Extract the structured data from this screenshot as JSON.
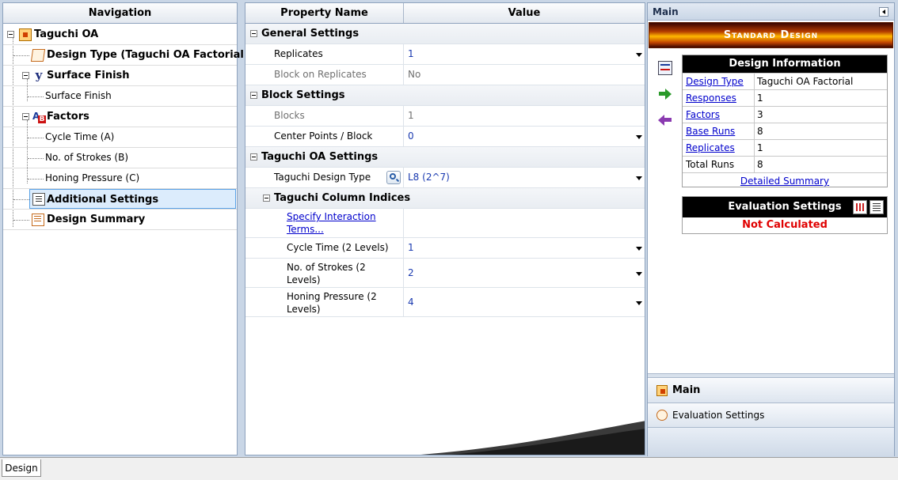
{
  "navigation": {
    "title": "Navigation",
    "items": [
      {
        "label": "Taguchi OA",
        "level": 0,
        "icon": "taguchi-oa-icon",
        "bold": true
      },
      {
        "label": "Design Type (Taguchi OA Factorial)",
        "level": 1,
        "icon": "design-type-icon",
        "bold": true
      },
      {
        "label": "Surface Finish",
        "level": 1,
        "icon": "response-y-icon",
        "bold": true
      },
      {
        "label": "Surface Finish",
        "level": 2,
        "bold": false
      },
      {
        "label": "Factors",
        "level": 1,
        "icon": "factors-ab-icon",
        "bold": true
      },
      {
        "label": "Cycle Time (A)",
        "level": 2,
        "bold": false
      },
      {
        "label": "No. of Strokes (B)",
        "level": 2,
        "bold": false
      },
      {
        "label": "Honing Pressure (C)",
        "level": 2,
        "bold": false
      },
      {
        "label": "Additional Settings",
        "level": 1,
        "icon": "list-settings-icon",
        "bold": true,
        "selected": true
      },
      {
        "label": "Design Summary",
        "level": 1,
        "icon": "design-summary-icon",
        "bold": true
      }
    ]
  },
  "grid": {
    "header_property": "Property Name",
    "header_value": "Value",
    "general": {
      "title": "General Settings",
      "replicates_label": "Replicates",
      "replicates_value": "1",
      "block_on_replicates_label": "Block on Replicates",
      "block_on_replicates_value": "No"
    },
    "block": {
      "title": "Block Settings",
      "blocks_label": "Blocks",
      "blocks_value": "1",
      "center_points_label": "Center Points / Block",
      "center_points_value": "0"
    },
    "taguchi": {
      "title": "Taguchi OA Settings",
      "design_type_label": "Taguchi Design Type",
      "design_type_value": "L8 (2^7)",
      "column_indices_title": "Taguchi Column Indices",
      "interaction_link_line1": "Specify Interaction",
      "interaction_link_line2": "Terms...",
      "cycle_time_label": "Cycle Time (2 Levels)",
      "cycle_time_value": "1",
      "strokes_label_line1": "No. of Strokes (2",
      "strokes_label_line2": "Levels)",
      "strokes_value": "2",
      "honing_label_line1": "Honing Pressure (2",
      "honing_label_line2": "Levels)",
      "honing_value": "4"
    }
  },
  "right_panel": {
    "title": "Main",
    "banner": "Standard Design",
    "design_info": {
      "title": "Design Information",
      "rows": [
        {
          "key": "Design Type",
          "value": "Taguchi OA Factorial",
          "link": true
        },
        {
          "key": "Responses",
          "value": "1",
          "link": true
        },
        {
          "key": "Factors",
          "value": "3",
          "link": true
        },
        {
          "key": "Base Runs",
          "value": "8",
          "link": true
        },
        {
          "key": "Replicates",
          "value": "1",
          "link": true
        },
        {
          "key": "Total Runs",
          "value": "8",
          "link": false
        }
      ],
      "detailed_summary": "Detailed Summary"
    },
    "evaluation": {
      "title": "Evaluation Settings",
      "status": "Not Calculated",
      "status_color": "#e00000"
    },
    "accordion": {
      "main_label": "Main",
      "evaluation_label": "Evaluation Settings"
    }
  },
  "bottom_tab": {
    "label": "Design"
  }
}
